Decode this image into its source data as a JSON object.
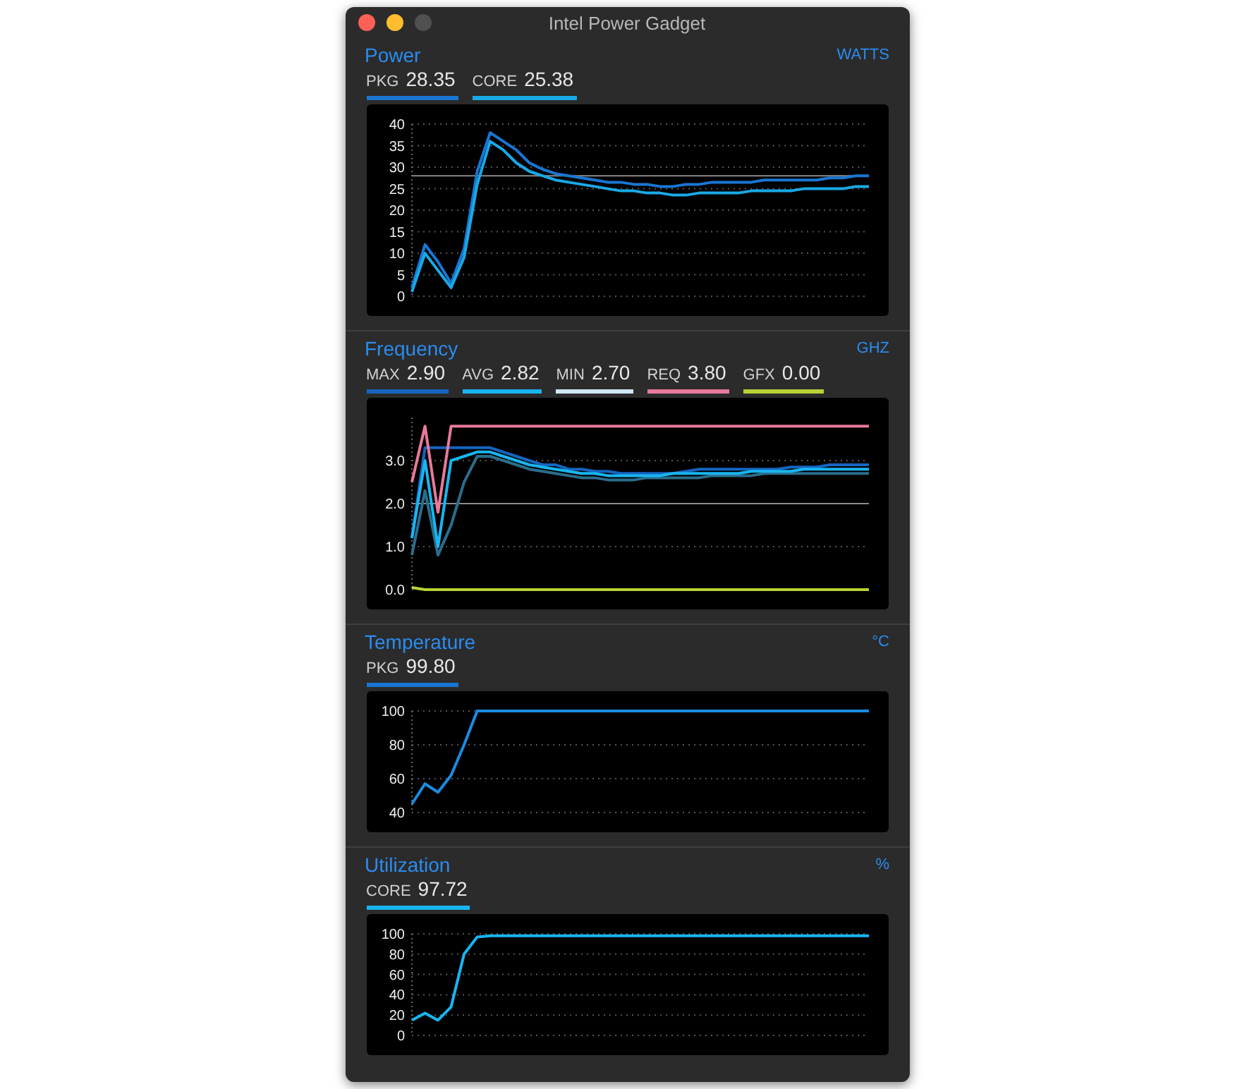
{
  "window": {
    "title": "Intel Power Gadget"
  },
  "panels": [
    {
      "title": "Power",
      "unit": "WATTS",
      "readings": [
        {
          "label": "PKG",
          "value": "28.35",
          "color": "#1976d2"
        },
        {
          "label": "CORE",
          "value": "25.38",
          "color": "#19a9e6"
        }
      ],
      "chart_data": {
        "type": "line",
        "ylim": [
          0,
          40
        ],
        "yticks": [
          0,
          5,
          10,
          15,
          20,
          25,
          30,
          35,
          40
        ],
        "grid": true,
        "ref_lines": [
          {
            "axis": "y",
            "value": 28
          }
        ],
        "series": [
          {
            "color": "#1976d2",
            "values": [
              2,
              12,
              8,
              3,
              11,
              29,
              38,
              36,
              34,
              31,
              29.5,
              28.5,
              28,
              27.5,
              27,
              26.5,
              26.5,
              26,
              26,
              25.5,
              25.5,
              26,
              26,
              26.5,
              26.5,
              26.5,
              26.5,
              27,
              27,
              27,
              27,
              27,
              27.5,
              27.5,
              28,
              28
            ]
          },
          {
            "color": "#19a9e6",
            "values": [
              1,
              10,
              6,
              2,
              9,
              26,
              36,
              34,
              31,
              29,
              28,
              27,
              26.5,
              26,
              25.5,
              25,
              24.5,
              24.5,
              24,
              24,
              23.5,
              23.5,
              24,
              24,
              24,
              24,
              24.5,
              24.5,
              24.5,
              24.5,
              25,
              25,
              25,
              25,
              25.5,
              25.5
            ]
          }
        ]
      }
    },
    {
      "title": "Frequency",
      "unit": "GHZ",
      "readings": [
        {
          "label": "MAX",
          "value": "2.90",
          "color": "#1565c0"
        },
        {
          "label": "AVG",
          "value": "2.82",
          "color": "#19b5f0"
        },
        {
          "label": "MIN",
          "value": "2.70",
          "color": "#cfe9f5"
        },
        {
          "label": "REQ",
          "value": "3.80",
          "color": "#e87a9a"
        },
        {
          "label": "GFX",
          "value": "0.00",
          "color": "#b5d334"
        }
      ],
      "chart_data": {
        "type": "line",
        "ylim": [
          0,
          4
        ],
        "yticks": [
          {
            "value": 0,
            "label": "0.0"
          },
          {
            "value": 1,
            "label": "1.0"
          },
          {
            "value": 2,
            "label": "2.0"
          },
          {
            "value": 3,
            "label": "3.0"
          }
        ],
        "grid": true,
        "ref_lines": [
          {
            "axis": "y",
            "value": 2
          }
        ],
        "series": [
          {
            "color": "#1565c0",
            "values": [
              1.2,
              3.3,
              3.3,
              3.3,
              3.3,
              3.3,
              3.3,
              3.2,
              3.1,
              3.0,
              2.9,
              2.9,
              2.8,
              2.8,
              2.75,
              2.75,
              2.7,
              2.7,
              2.7,
              2.7,
              2.7,
              2.75,
              2.8,
              2.8,
              2.8,
              2.8,
              2.8,
              2.8,
              2.8,
              2.85,
              2.85,
              2.85,
              2.9,
              2.9,
              2.9,
              2.9
            ]
          },
          {
            "color": "#2a6d8c",
            "values": [
              0.8,
              2.3,
              0.8,
              1.5,
              2.5,
              3.1,
              3.1,
              3,
              2.9,
              2.8,
              2.75,
              2.7,
              2.65,
              2.6,
              2.6,
              2.55,
              2.55,
              2.55,
              2.6,
              2.6,
              2.6,
              2.6,
              2.6,
              2.65,
              2.65,
              2.65,
              2.65,
              2.7,
              2.7,
              2.7,
              2.7,
              2.7,
              2.7,
              2.7,
              2.7,
              2.7
            ]
          },
          {
            "color": "#19b5f0",
            "values": [
              1.2,
              3,
              1,
              3,
              3.1,
              3.2,
              3.2,
              3.1,
              3,
              2.9,
              2.85,
              2.8,
              2.75,
              2.7,
              2.7,
              2.65,
              2.65,
              2.65,
              2.65,
              2.65,
              2.7,
              2.7,
              2.7,
              2.7,
              2.7,
              2.7,
              2.75,
              2.75,
              2.75,
              2.75,
              2.8,
              2.8,
              2.8,
              2.8,
              2.8,
              2.8
            ]
          },
          {
            "color": "#e87a9a",
            "values": [
              2.5,
              3.8,
              1.8,
              3.8,
              3.8,
              3.8,
              3.8,
              3.8,
              3.8,
              3.8,
              3.8,
              3.8,
              3.8,
              3.8,
              3.8,
              3.8,
              3.8,
              3.8,
              3.8,
              3.8,
              3.8,
              3.8,
              3.8,
              3.8,
              3.8,
              3.8,
              3.8,
              3.8,
              3.8,
              3.8,
              3.8,
              3.8,
              3.8,
              3.8,
              3.8,
              3.8
            ]
          },
          {
            "color": "#b5d334",
            "values": [
              0.05,
              0,
              0,
              0,
              0,
              0,
              0,
              0,
              0,
              0,
              0,
              0,
              0,
              0,
              0,
              0,
              0,
              0,
              0,
              0,
              0,
              0,
              0,
              0,
              0,
              0,
              0,
              0,
              0,
              0,
              0,
              0,
              0,
              0,
              0,
              0
            ]
          }
        ]
      }
    },
    {
      "title": "Temperature",
      "unit": "°C",
      "readings": [
        {
          "label": "PKG",
          "value": "99.80",
          "color": "#1976d2"
        }
      ],
      "chart_data": {
        "type": "line",
        "ylim": [
          40,
          100
        ],
        "yticks": [
          40,
          60,
          80,
          100
        ],
        "grid": true,
        "series": [
          {
            "color": "#1b8be0",
            "values": [
              45,
              57,
              52,
              62,
              80,
              100,
              100,
              100,
              100,
              100,
              100,
              100,
              100,
              100,
              100,
              100,
              100,
              100,
              100,
              100,
              100,
              100,
              100,
              100,
              100,
              100,
              100,
              100,
              100,
              100,
              100,
              100,
              100,
              100,
              100,
              100
            ]
          }
        ]
      }
    },
    {
      "title": "Utilization",
      "unit": "%",
      "readings": [
        {
          "label": "CORE",
          "value": "97.72",
          "color": "#19b5f0"
        }
      ],
      "chart_data": {
        "type": "line",
        "ylim": [
          0,
          100
        ],
        "yticks": [
          0,
          20,
          40,
          60,
          80,
          100
        ],
        "grid": true,
        "series": [
          {
            "color": "#19b5f0",
            "values": [
              15,
              22,
              15,
              28,
              80,
              97,
              98,
              98,
              98,
              98,
              98,
              98,
              98,
              98,
              98,
              98,
              98,
              98,
              98,
              98,
              98,
              98,
              98,
              98,
              98,
              98,
              98,
              98,
              98,
              98,
              98,
              98,
              98,
              98,
              98,
              98
            ]
          }
        ]
      }
    }
  ]
}
